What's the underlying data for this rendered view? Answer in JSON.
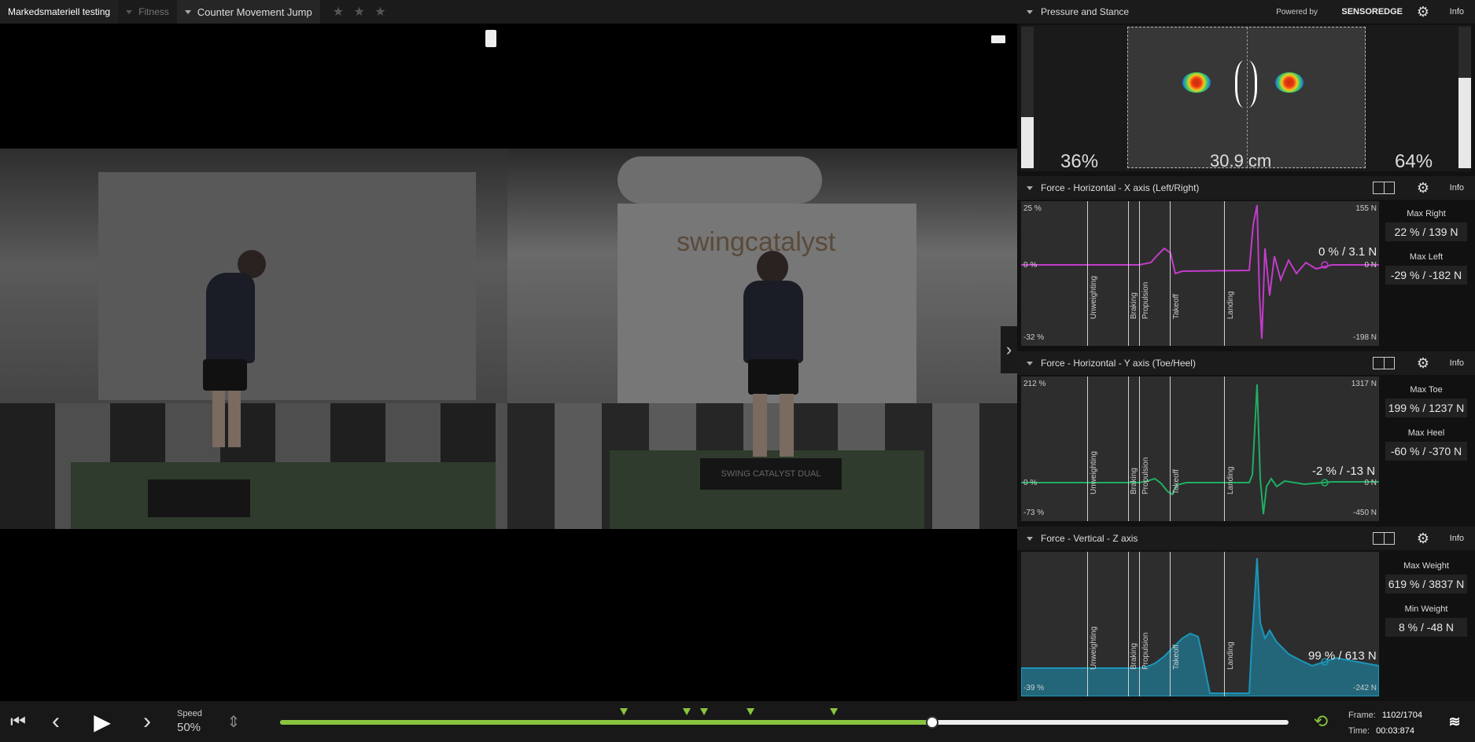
{
  "topbar": {
    "project": "Markedsmateriell testing",
    "category": "Fitness",
    "test": "Counter Movement Jump",
    "stars": "★ ★ ★"
  },
  "pressure": {
    "title": "Pressure and Stance",
    "powered_by": "Powered by",
    "brand": "SENSOREDGE",
    "info": "Info",
    "left_pct": "36%",
    "right_pct": "64%",
    "stance_width": "30.9 cm",
    "left_level": 0.36,
    "right_level": 0.64
  },
  "panels": {
    "x": {
      "title": "Force - Horizontal - X axis (Left/Right)",
      "info": "Info",
      "y_top_pct": "25 %",
      "y_zero_pct": "0 %",
      "y_bot_pct": "-32 %",
      "y_top_n": "155 N",
      "y_zero_n": "0 N",
      "y_bot_n": "-198 N",
      "readout": "0 % / 3.1 N",
      "color": "#c23cc9",
      "stat1_label": "Max Right",
      "stat1_value": "22 % / 139 N",
      "stat2_label": "Max Left",
      "stat2_value": "-29 % / -182 N"
    },
    "y": {
      "title": "Force - Horizontal - Y axis (Toe/Heel)",
      "info": "Info",
      "y_top_pct": "212 %",
      "y_zero_pct": "0 %",
      "y_bot_pct": "-73 %",
      "y_top_n": "1317 N",
      "y_zero_n": "0 N",
      "y_bot_n": "-450 N",
      "readout": "-2 % / -13 N",
      "color": "#1fae62",
      "stat1_label": "Max Toe",
      "stat1_value": "199 % / 1237 N",
      "stat2_label": "Max Heel",
      "stat2_value": "-60 % / -370 N"
    },
    "z": {
      "title": "Force - Vertical - Z axis",
      "info": "Info",
      "y_bot_pct": "-39 %",
      "y_bot_n": "-242 N",
      "readout": "99 % / 613 N",
      "color": "#1b95b8",
      "stat1_label": "Max Weight",
      "stat1_value": "619 % / 3837 N",
      "stat2_label": "Min Weight",
      "stat2_value": "8 % / -48 N"
    }
  },
  "events": [
    "Unweighting",
    "Braking",
    "Propulsion",
    "Takeoff",
    "Landing"
  ],
  "video": {
    "brand_text": "swingcatalyst",
    "mat_text": "SWING CATALYST DUAL"
  },
  "player": {
    "speed_label": "Speed",
    "speed_value": "50%",
    "frame_label": "Frame:",
    "frame_value": "1102/1704",
    "time_label": "Time:",
    "time_value": "00:03:874",
    "progress": 0.647
  }
}
